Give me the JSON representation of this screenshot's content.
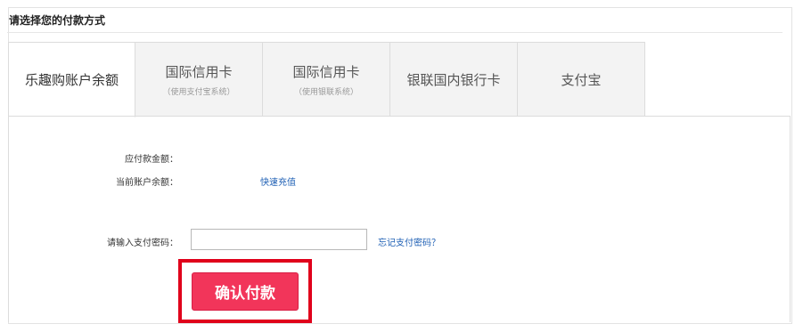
{
  "header": {
    "title": "请选择您的付款方式"
  },
  "tabs": [
    {
      "label": "乐趣购账户余额",
      "sub": ""
    },
    {
      "label": "国际信用卡",
      "sub": "（使用支付宝系统）"
    },
    {
      "label": "国际信用卡",
      "sub": "（使用银联系统）"
    },
    {
      "label": "银联国内银行卡",
      "sub": ""
    },
    {
      "label": "支付宝",
      "sub": ""
    }
  ],
  "form": {
    "amount_due_label": "应付款金额：",
    "balance_label": "当前账户余额：",
    "recharge_link": "快速充值",
    "password_label": "请输入支付密码：",
    "password_value": "",
    "forgot_link": "忘记支付密码？",
    "confirm_label": "确认付款"
  },
  "colors": {
    "accent": "#f2355a",
    "highlight": "#e0001b",
    "link": "#1e5fb4"
  }
}
